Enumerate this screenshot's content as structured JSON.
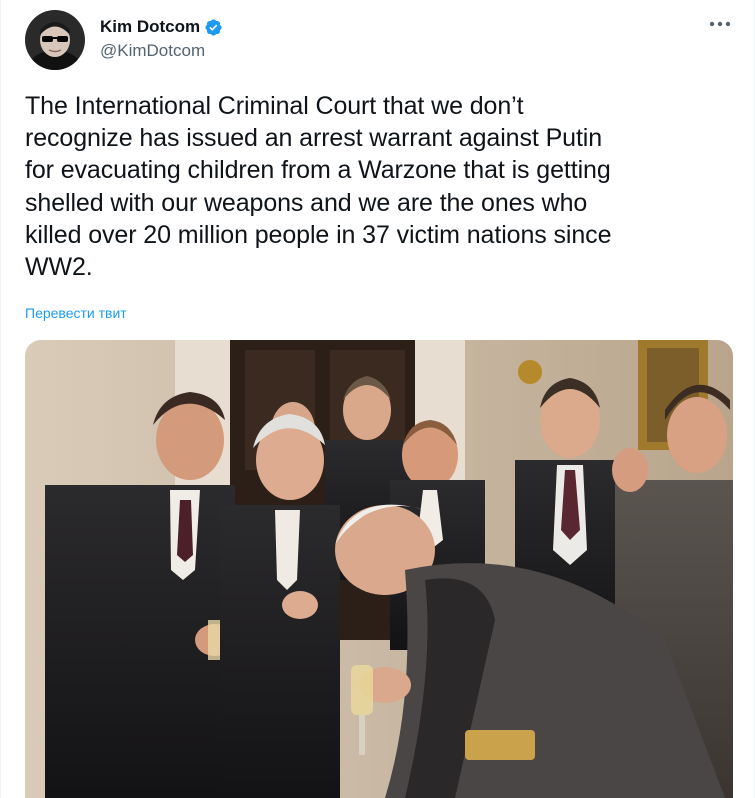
{
  "author": {
    "display_name": "Kim Dotcom",
    "handle": "@KimDotcom",
    "verified": true
  },
  "tweet": {
    "text": "The International Criminal Court that we don’t\nrecognize has issued an arrest warrant against Putin\nfor evacuating children from a Warzone that is getting\nshelled with our weapons and we are the ones who\nkilled over 20 million people in 37 victim nations since\nWW2.",
    "translate_label": "Перевести твит"
  },
  "icons": {
    "verified": "verified-badge-icon",
    "more": "more-options-icon"
  },
  "colors": {
    "text": "#0f1419",
    "secondary": "#536471",
    "link": "#1d9bf0",
    "verified": "#1d9bf0"
  }
}
